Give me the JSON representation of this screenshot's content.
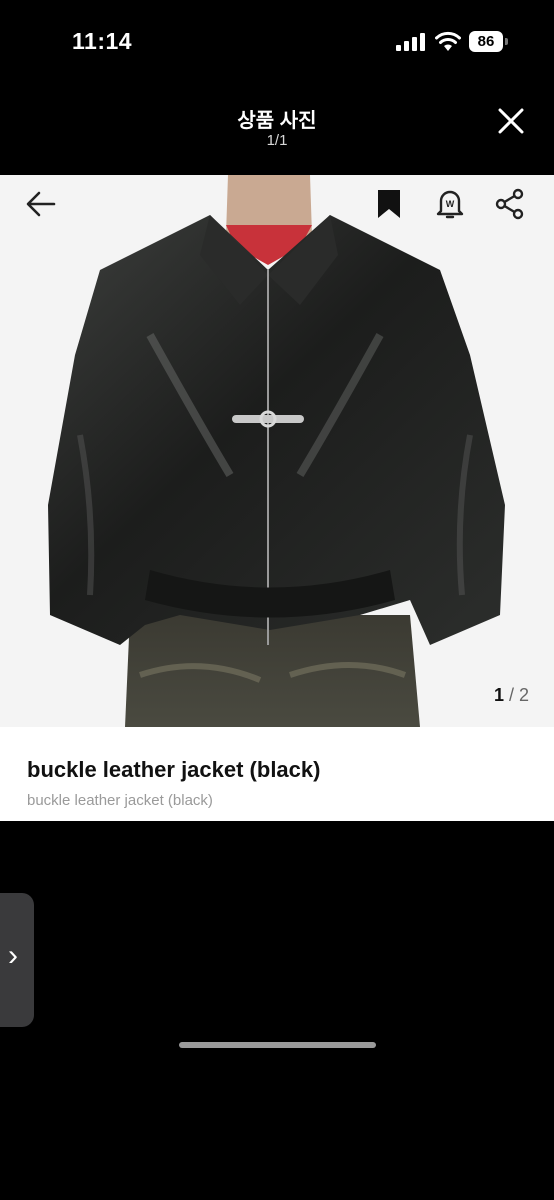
{
  "status_bar": {
    "time": "11:14",
    "battery": "86"
  },
  "viewer": {
    "title": "상품 사진",
    "counter": "1/1"
  },
  "product": {
    "title": "buckle leather jacket (black)",
    "subtitle": "buckle leather jacket (black)",
    "page_current": "1",
    "page_separator": " / ",
    "page_total": "2"
  },
  "icons": {
    "back": "arrow-left-icon",
    "bookmark": "bookmark-icon",
    "alert": "bell-icon",
    "share": "share-icon",
    "close": "close-icon",
    "side": "chevron-right-icon"
  },
  "colors": {
    "background": "#000000",
    "card": "#ffffff",
    "subtitle": "#9a9a9a"
  }
}
